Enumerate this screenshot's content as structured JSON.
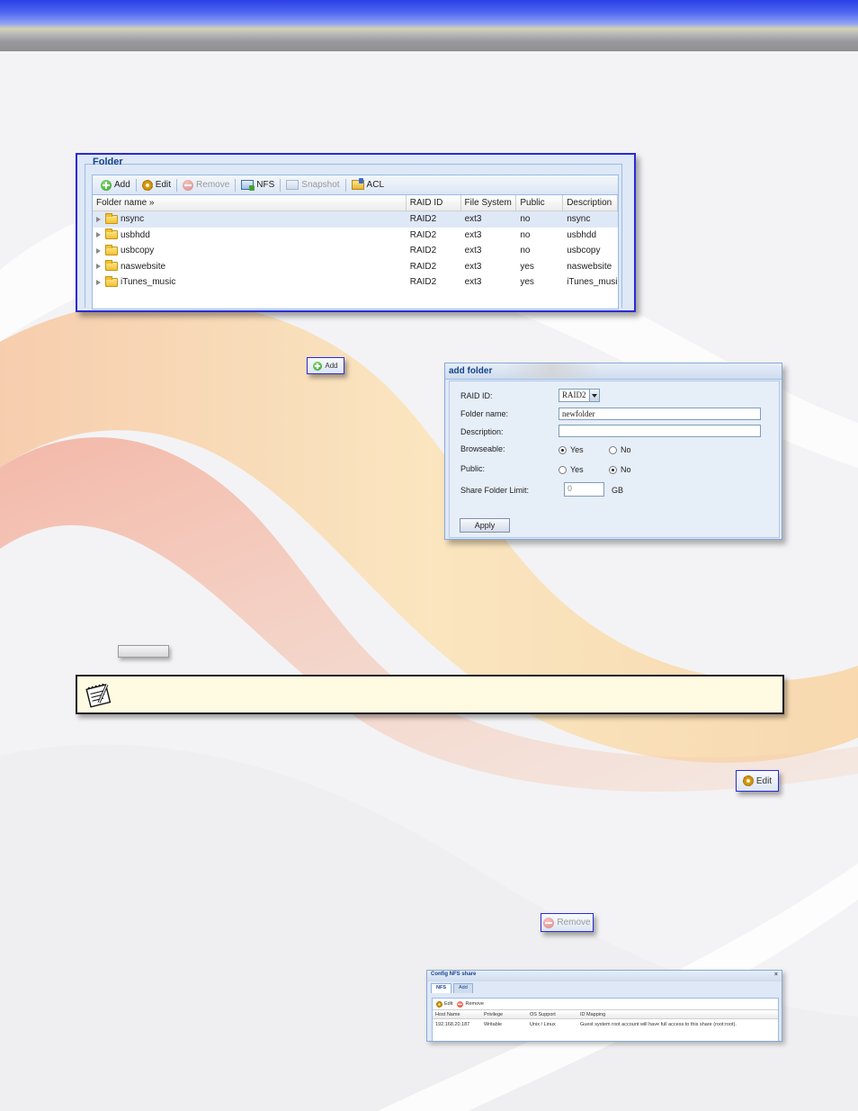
{
  "folder_panel": {
    "legend": "Folder",
    "toolbar": {
      "add": "Add",
      "edit": "Edit",
      "remove": "Remove",
      "nfs": "NFS",
      "snapshot": "Snapshot",
      "acl": "ACL"
    },
    "columns": [
      "Folder name »",
      "RAID ID",
      "File System",
      "Public",
      "Description"
    ],
    "rows": [
      {
        "name": "nsync",
        "raid": "RAID2",
        "fs": "ext3",
        "public": "no",
        "desc": "nsync"
      },
      {
        "name": "usbhdd",
        "raid": "RAID2",
        "fs": "ext3",
        "public": "no",
        "desc": "usbhdd"
      },
      {
        "name": "usbcopy",
        "raid": "RAID2",
        "fs": "ext3",
        "public": "no",
        "desc": "usbcopy"
      },
      {
        "name": "naswebsite",
        "raid": "RAID2",
        "fs": "ext3",
        "public": "yes",
        "desc": "naswebsite"
      },
      {
        "name": "iTunes_music",
        "raid": "RAID2",
        "fs": "ext3",
        "public": "yes",
        "desc": "iTunes_music"
      }
    ]
  },
  "add_button": {
    "label": "Add"
  },
  "add_folder_dialog": {
    "title": "add folder",
    "raid_label": "RAID ID:",
    "raid_value": "RAID2",
    "folder_name_label": "Folder name:",
    "folder_name_value": "newfolder",
    "description_label": "Description:",
    "description_value": "",
    "browseable_label": "Browseable:",
    "browseable_yes": "Yes",
    "browseable_no": "No",
    "browseable_selected": "Yes",
    "public_label": "Public:",
    "public_yes": "Yes",
    "public_no": "No",
    "public_selected": "No",
    "limit_label": "Share Folder Limit:",
    "limit_value": "0",
    "limit_unit": "GB",
    "apply": "Apply"
  },
  "edit_button": {
    "label": "Edit"
  },
  "remove_button": {
    "label": "Remove"
  },
  "nfs_dialog": {
    "title": "Config NFS share",
    "tabs": [
      "NFS",
      "Add"
    ],
    "toolbar": {
      "edit": "Edit",
      "remove": "Remove"
    },
    "columns": [
      "Host Name",
      "Privilege",
      "OS Support",
      "ID Mapping"
    ],
    "rows": [
      {
        "host": "192.168.20.187",
        "privilege": "Writable",
        "os": "Unix / Linux",
        "mapping": "Guest system root account will have full access to this share (root:root)."
      }
    ]
  },
  "colors": {
    "frame_border": "#2a2ad8",
    "panel_bg": "#dfe8f6",
    "note_bg": "#fffbe2",
    "top_band": "#2a3fe8"
  }
}
